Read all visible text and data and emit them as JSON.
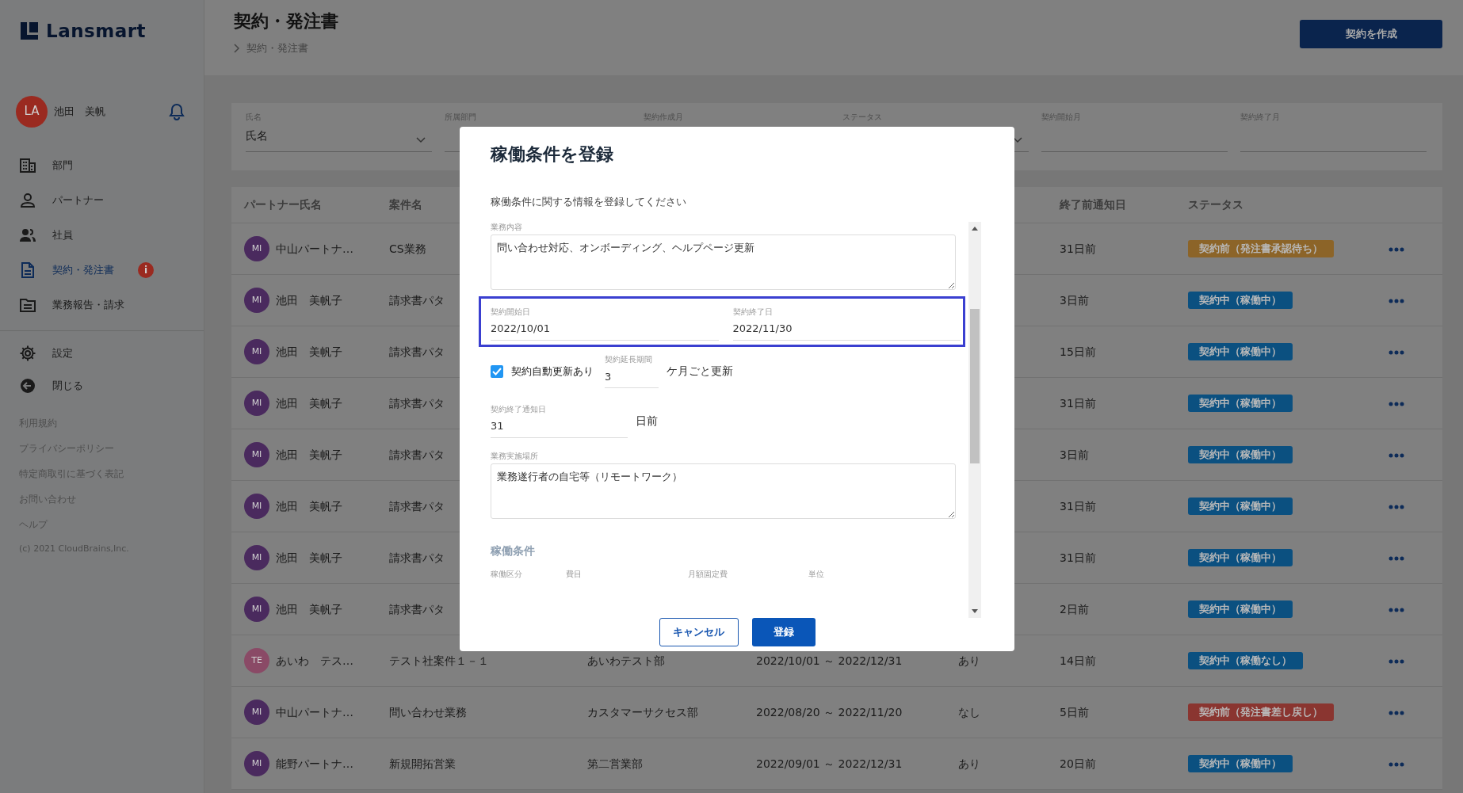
{
  "sidebar": {
    "logo": "Lansmart",
    "user": {
      "initials": "LA",
      "name": "池田　美帆"
    },
    "nav": [
      {
        "label": "部門",
        "selected": false
      },
      {
        "label": "パートナー",
        "selected": false
      },
      {
        "label": "社員",
        "selected": false
      },
      {
        "label": "契約・発注書",
        "selected": true,
        "badge": "i"
      },
      {
        "label": "業務報告・請求",
        "selected": false
      }
    ],
    "bottom_nav": [
      "設定",
      "閉じる"
    ],
    "footer_links": [
      "利用規約",
      "プライバシーポリシー",
      "特定商取引に基づく表記",
      "お問い合わせ",
      "ヘルプ"
    ],
    "copyright": "(c) 2021 CloudBrains,Inc."
  },
  "header": {
    "title": "契約・発注書",
    "breadcrumb": [
      "契約・発注書"
    ],
    "create_button": "契約を作成"
  },
  "filters": [
    {
      "label": "氏名",
      "value": "氏名",
      "kind": "select"
    },
    {
      "label": "所属部門",
      "kind": "text"
    },
    {
      "label": "契約作成月",
      "kind": "text"
    },
    {
      "label": "ステータス",
      "kind": "select"
    },
    {
      "label": "契約開始月",
      "kind": "text"
    },
    {
      "label": "契約終了月",
      "kind": "text"
    }
  ],
  "table": {
    "columns": {
      "partner": "パートナー氏名",
      "project": "案件名",
      "notice": "終了前通知日",
      "status": "ステータス"
    },
    "rows": [
      {
        "avatar": {
          "initials": "MI",
          "color": "#4a2a5e"
        },
        "partner": "中山パートナ…",
        "project": "CS業務",
        "notice": "31日前",
        "status": {
          "label": "契約前（発注書承認待ち）",
          "color": "#8c6428"
        }
      },
      {
        "avatar": {
          "initials": "MI",
          "color": "#4a2a5e"
        },
        "partner": "池田　美帆子",
        "project": "請求書パタ",
        "notice": "3日前",
        "status": {
          "label": "契約中（稼働中）",
          "color": "#0b5080"
        }
      },
      {
        "avatar": {
          "initials": "MI",
          "color": "#4a2a5e"
        },
        "partner": "池田　美帆子",
        "project": "請求書パタ",
        "notice": "15日前",
        "status": {
          "label": "契約中（稼働中）",
          "color": "#0b5080"
        }
      },
      {
        "avatar": {
          "initials": "MI",
          "color": "#4a2a5e"
        },
        "partner": "池田　美帆子",
        "project": "請求書パタ",
        "notice": "31日前",
        "status": {
          "label": "契約中（稼働中）",
          "color": "#0b5080"
        }
      },
      {
        "avatar": {
          "initials": "MI",
          "color": "#4a2a5e"
        },
        "partner": "池田　美帆子",
        "project": "請求書パタ",
        "notice": "3日前",
        "status": {
          "label": "契約中（稼働中）",
          "color": "#0b5080"
        }
      },
      {
        "avatar": {
          "initials": "MI",
          "color": "#4a2a5e"
        },
        "partner": "池田　美帆子",
        "project": "請求書パタ",
        "notice": "31日前",
        "status": {
          "label": "契約中（稼働中）",
          "color": "#0b5080"
        }
      },
      {
        "avatar": {
          "initials": "MI",
          "color": "#4a2a5e"
        },
        "partner": "池田　美帆子",
        "project": "請求書パタ",
        "notice": "31日前",
        "status": {
          "label": "契約中（稼働中）",
          "color": "#0b5080"
        }
      },
      {
        "avatar": {
          "initials": "MI",
          "color": "#4a2a5e"
        },
        "partner": "池田　美帆子",
        "project": "請求書パタ",
        "notice": "2日前",
        "status": {
          "label": "契約中（稼働中）",
          "color": "#0b5080"
        }
      },
      {
        "avatar": {
          "initials": "TE",
          "color": "#8a4a66"
        },
        "partner": "あいわ　テス…",
        "project": "テスト社案件１－１",
        "department": "あいわテスト部",
        "period": "2022/10/01 ～ 2022/12/31",
        "auto_renew": "あり",
        "notice": "14日前",
        "status": {
          "label": "契約中（稼働なし）",
          "color": "#0b5080"
        }
      },
      {
        "avatar": {
          "initials": "MI",
          "color": "#4a2a5e"
        },
        "partner": "中山パートナ…",
        "project": "問い合わせ業務",
        "department": "カスタマーサクセス部",
        "period": "2022/08/20 ～ 2022/11/20",
        "auto_renew": "なし",
        "notice": "5日前",
        "status": {
          "label": "契約前（発注書差し戻し）",
          "color": "#8a3530"
        }
      },
      {
        "avatar": {
          "initials": "MI",
          "color": "#4a2a5e"
        },
        "partner": "能野パートナ…",
        "project": "新規開拓営業",
        "department": "第二営業部",
        "period": "2022/09/01 ～ 2022/12/31",
        "auto_renew": "あり",
        "notice": "20日前",
        "status": {
          "label": "契約中（稼働中）",
          "color": "#0b5080"
        }
      }
    ]
  },
  "modal": {
    "title": "稼働条件を登録",
    "description": "稼働条件に関する情報を登録してください",
    "work_content": {
      "label": "業務内容",
      "value": "問い合わせ対応、オンボーディング、ヘルプページ更新"
    },
    "period": {
      "highlighted": true,
      "start": {
        "label": "契約開始日",
        "value": "2022/10/01"
      },
      "end": {
        "label": "契約終了日",
        "value": "2022/11/30"
      }
    },
    "auto_renew": {
      "label": "契約自動更新あり",
      "checked": true,
      "extension": {
        "label": "契約延長期間",
        "value": "3"
      },
      "suffix": "ケ月ごと更新"
    },
    "notice": {
      "label": "契約終了通知日",
      "value": "31",
      "suffix": "日前"
    },
    "work_place": {
      "label": "業務実施場所",
      "value": "業務遂行者の自宅等（リモートワーク）"
    },
    "section": {
      "title": "稼働条件",
      "columns": [
        "稼働区分",
        "費目",
        "月額固定費",
        "単位"
      ]
    },
    "buttons": {
      "cancel": "キャンセル",
      "submit": "登録"
    }
  }
}
